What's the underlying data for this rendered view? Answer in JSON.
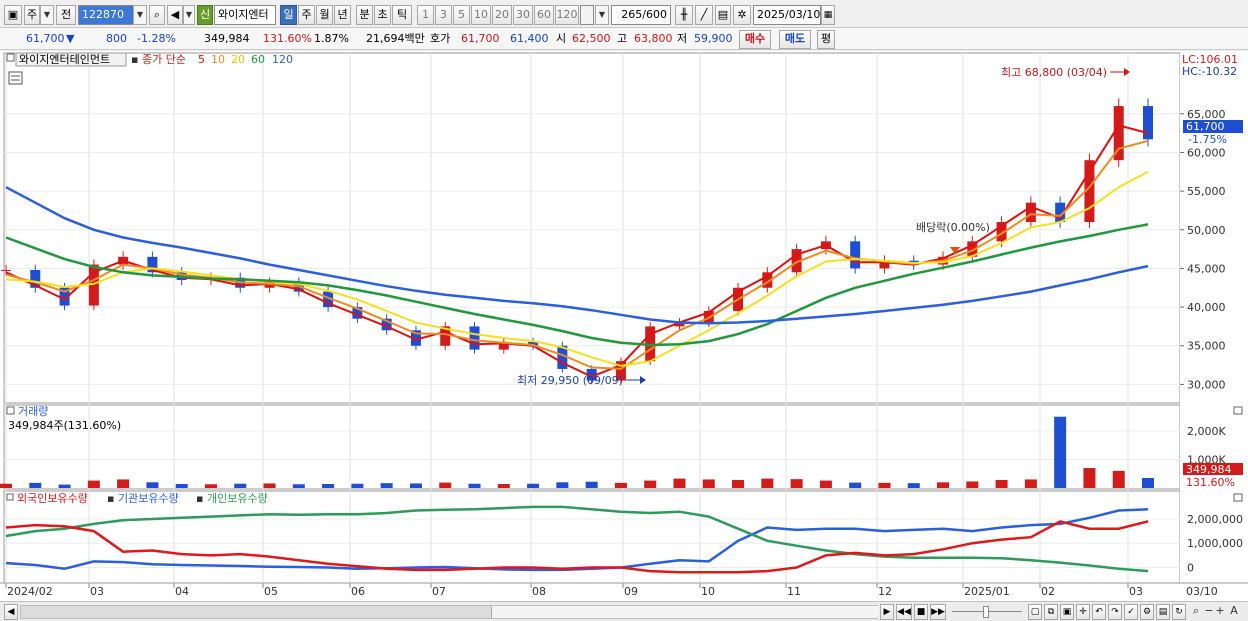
{
  "toolbar": {
    "period_label": "주",
    "prev_label": "전",
    "code": "122870",
    "new_badge": "신",
    "stock_name": "와이지엔터",
    "period_buttons": [
      "일",
      "주",
      "월",
      "년",
      "분",
      "초",
      "틱"
    ],
    "interval_buttons": [
      "1",
      "3",
      "5",
      "10",
      "20",
      "30",
      "60",
      "120"
    ],
    "count_value": "265",
    "count_total": "/600",
    "date_value": "2025/03/10"
  },
  "quote": {
    "price": "61,700",
    "change_arrow": "▼",
    "change": "800",
    "change_pct": "-1.28%",
    "volume": "349,984",
    "volume_ratio": "131.60%",
    "turnover_pct": "1.87%",
    "amount": "21,694백만",
    "bid_label": "호가",
    "bid1": "61,700",
    "bid2": "61,400",
    "open_label": "시",
    "open": "62,500",
    "high_label": "고",
    "high": "63,800",
    "low_label": "저",
    "low": "59,900",
    "buy_label": "매수",
    "sell_label": "매도",
    "eval_label": "평"
  },
  "price_panel": {
    "name_chip": "와이지엔터테인먼트",
    "legend_prefix": "종가 단순",
    "ma_periods": [
      "5",
      "10",
      "20",
      "60",
      "120"
    ],
    "lc_label": "LC:106.01",
    "hc_label": "HC:-10.32",
    "last_price_tag": "61,700",
    "last_pct_tag": "-1.75%",
    "high_annotation": "최고 68,800 (03/04)",
    "low_annotation": "최저 29,950 (09/09)",
    "dividend_annotation": "배당락(0.00%)",
    "y_ticks": [
      "65,000",
      "60,000",
      "55,000",
      "50,000",
      "45,000",
      "40,000",
      "35,000",
      "30,000"
    ]
  },
  "volume_panel": {
    "title": "거래량",
    "value_text": "349,984주(131.60%)",
    "y_ticks": [
      "2,000K",
      "1,000K"
    ],
    "last_tag": "349,984",
    "ratio_tag": "131.60%"
  },
  "holding_panel": {
    "legend": [
      "외국인보유수량",
      "기관보유수량",
      "개인보유수량"
    ],
    "y_ticks": [
      "2,000,000",
      "1,000,000",
      "0"
    ]
  },
  "x_axis": {
    "labels": [
      "2024/02",
      "03",
      "04",
      "05",
      "06",
      "07",
      "08",
      "09",
      "10",
      "11",
      "12",
      "2025/01",
      "02",
      "03"
    ],
    "right_label": "03/10"
  },
  "colors": {
    "up": "#d21c1c",
    "down": "#1f4fd0",
    "ma5": "#e01010",
    "ma10": "#f08a1e",
    "ma20": "#f5e11a",
    "ma60": "#1e9a3c",
    "ma120": "#2a5fe0",
    "foreign": "#2a5fe0",
    "institution": "#2e9a5c",
    "individual": "#e01818"
  },
  "chart_data": {
    "type": "line",
    "title": "와이지엔터테인먼트",
    "x": [
      "2024/02",
      "03",
      "04",
      "05",
      "06",
      "07",
      "08",
      "09",
      "10",
      "11",
      "12",
      "2025/01",
      "02",
      "03"
    ],
    "ylim": [
      28500,
      69500
    ],
    "price_points": [
      [
        0,
        44800
      ],
      [
        1,
        42500
      ],
      [
        2,
        40200
      ],
      [
        3,
        45500
      ],
      [
        4,
        46500
      ],
      [
        5,
        44500
      ],
      [
        6,
        43500
      ],
      [
        7,
        43800
      ],
      [
        8,
        42500
      ],
      [
        9,
        43200
      ],
      [
        10,
        42000
      ],
      [
        11,
        40000
      ],
      [
        12,
        38500
      ],
      [
        13,
        37000
      ],
      [
        14,
        35000
      ],
      [
        15,
        37500
      ],
      [
        16,
        34500
      ],
      [
        17,
        35500
      ],
      [
        18,
        35000
      ],
      [
        19,
        32000
      ],
      [
        20,
        30500
      ],
      [
        21,
        33000
      ],
      [
        22,
        37500
      ],
      [
        23,
        38000
      ],
      [
        24,
        39500
      ],
      [
        25,
        42500
      ],
      [
        26,
        44500
      ],
      [
        27,
        47500
      ],
      [
        28,
        48500
      ],
      [
        29,
        45000
      ],
      [
        30,
        46000
      ],
      [
        31,
        45500
      ],
      [
        32,
        46500
      ],
      [
        33,
        48500
      ],
      [
        34,
        51000
      ],
      [
        35,
        53500
      ],
      [
        36,
        51000
      ],
      [
        37,
        59000
      ],
      [
        38,
        66000
      ],
      [
        39,
        61700
      ]
    ],
    "series": [
      {
        "name": "5",
        "values": [
          44500,
          42800,
          41000,
          44500,
          46000,
          44800,
          43800,
          43600,
          42800,
          43000,
          42300,
          40500,
          39000,
          37500,
          35800,
          36800,
          35200,
          35300,
          35000,
          32800,
          31000,
          32500,
          36500,
          38000,
          39300,
          42000,
          44000,
          46800,
          48000,
          45800,
          45800,
          45500,
          46300,
          48000,
          50500,
          53000,
          51500,
          57500,
          63500,
          62500
        ]
      },
      {
        "name": "10",
        "values": [
          44200,
          43200,
          42000,
          43500,
          45500,
          45000,
          44200,
          43800,
          43200,
          43000,
          42700,
          41200,
          39800,
          38200,
          36600,
          36500,
          35700,
          35400,
          35100,
          33800,
          32200,
          32000,
          34500,
          37000,
          38600,
          41000,
          43200,
          45800,
          47300,
          46300,
          45900,
          45600,
          46000,
          47300,
          49500,
          52000,
          51800,
          55500,
          60500,
          61500
        ]
      },
      {
        "name": "20",
        "values": [
          43600,
          43300,
          42600,
          43000,
          44500,
          45000,
          44600,
          44100,
          43600,
          43300,
          43000,
          42100,
          41000,
          39500,
          38000,
          37200,
          36500,
          36000,
          35600,
          34800,
          33500,
          32400,
          33000,
          35000,
          37000,
          39200,
          41500,
          44000,
          45900,
          46200,
          46000,
          45700,
          45800,
          46600,
          48300,
          50300,
          51000,
          52800,
          55500,
          57500
        ]
      },
      {
        "name": "60",
        "values": [
          49000,
          47600,
          46200,
          45200,
          44500,
          44100,
          43900,
          43700,
          43600,
          43400,
          43200,
          42800,
          42200,
          41500,
          40700,
          39900,
          39100,
          38400,
          37700,
          36900,
          36000,
          35400,
          35100,
          35200,
          35600,
          36500,
          37800,
          39500,
          41200,
          42500,
          43400,
          44300,
          45100,
          45900,
          46800,
          47700,
          48500,
          49200,
          50000,
          50700
        ]
      },
      {
        "name": "120",
        "values": [
          55500,
          53500,
          51500,
          50000,
          49000,
          48300,
          47700,
          47000,
          46300,
          45500,
          44800,
          44100,
          43400,
          42700,
          42100,
          41600,
          41200,
          40800,
          40500,
          40100,
          39600,
          39000,
          38400,
          38000,
          37900,
          38000,
          38200,
          38500,
          38800,
          39100,
          39500,
          39900,
          40300,
          40800,
          41400,
          42000,
          42800,
          43600,
          44500,
          45300
        ]
      }
    ],
    "volume_values_k": [
      150,
      180,
      120,
      260,
      300,
      200,
      140,
      130,
      150,
      160,
      130,
      140,
      150,
      170,
      160,
      190,
      150,
      140,
      150,
      200,
      220,
      180,
      260,
      330,
      300,
      280,
      330,
      310,
      260,
      190,
      180,
      170,
      200,
      230,
      280,
      300,
      2500,
      700,
      600,
      350
    ],
    "holding_series": [
      {
        "name": "외국인보유수량",
        "values": [
          180000,
          100000,
          -50000,
          250000,
          220000,
          130000,
          100000,
          80000,
          60000,
          30000,
          20000,
          0,
          -50000,
          -30000,
          0,
          20000,
          -30000,
          -80000,
          -100000,
          -100000,
          -50000,
          0,
          150000,
          300000,
          250000,
          1100000,
          1650000,
          1550000,
          1600000,
          1600000,
          1500000,
          1550000,
          1600000,
          1500000,
          1650000,
          1750000,
          1800000,
          2050000,
          2350000,
          2400000
        ]
      },
      {
        "name": "기관보유수량",
        "values": [
          1300000,
          1500000,
          1600000,
          1800000,
          1950000,
          2000000,
          2050000,
          2100000,
          2150000,
          2200000,
          2180000,
          2200000,
          2200000,
          2250000,
          2350000,
          2380000,
          2400000,
          2450000,
          2500000,
          2500000,
          2400000,
          2300000,
          2250000,
          2300000,
          2100000,
          1600000,
          1100000,
          900000,
          700000,
          550000,
          450000,
          400000,
          400000,
          400000,
          380000,
          300000,
          200000,
          80000,
          -50000,
          -150000
        ]
      },
      {
        "name": "개인보유수량",
        "values": [
          1650000,
          1750000,
          1700000,
          1500000,
          650000,
          700000,
          550000,
          500000,
          550000,
          450000,
          300000,
          150000,
          50000,
          -50000,
          -100000,
          -100000,
          -50000,
          0,
          0,
          -50000,
          0,
          0,
          -150000,
          -200000,
          -200000,
          -200000,
          -150000,
          0,
          500000,
          600000,
          500000,
          550000,
          750000,
          1000000,
          1150000,
          1250000,
          1900000,
          1600000,
          1600000,
          1900000
        ]
      }
    ]
  }
}
